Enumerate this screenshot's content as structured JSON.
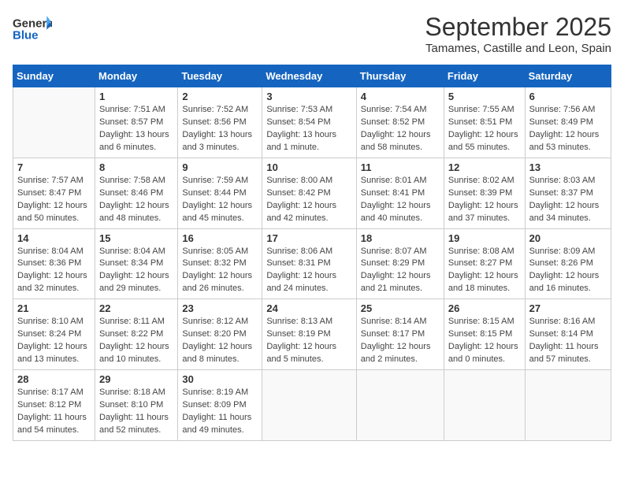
{
  "header": {
    "logo_line1": "General",
    "logo_line2": "Blue",
    "title": "September 2025",
    "subtitle": "Tamames, Castille and Leon, Spain"
  },
  "weekdays": [
    "Sunday",
    "Monday",
    "Tuesday",
    "Wednesday",
    "Thursday",
    "Friday",
    "Saturday"
  ],
  "weeks": [
    [
      {
        "day": "",
        "sunrise": "",
        "sunset": "",
        "daylight": ""
      },
      {
        "day": "1",
        "sunrise": "Sunrise: 7:51 AM",
        "sunset": "Sunset: 8:57 PM",
        "daylight": "Daylight: 13 hours and 6 minutes."
      },
      {
        "day": "2",
        "sunrise": "Sunrise: 7:52 AM",
        "sunset": "Sunset: 8:56 PM",
        "daylight": "Daylight: 13 hours and 3 minutes."
      },
      {
        "day": "3",
        "sunrise": "Sunrise: 7:53 AM",
        "sunset": "Sunset: 8:54 PM",
        "daylight": "Daylight: 13 hours and 1 minute."
      },
      {
        "day": "4",
        "sunrise": "Sunrise: 7:54 AM",
        "sunset": "Sunset: 8:52 PM",
        "daylight": "Daylight: 12 hours and 58 minutes."
      },
      {
        "day": "5",
        "sunrise": "Sunrise: 7:55 AM",
        "sunset": "Sunset: 8:51 PM",
        "daylight": "Daylight: 12 hours and 55 minutes."
      },
      {
        "day": "6",
        "sunrise": "Sunrise: 7:56 AM",
        "sunset": "Sunset: 8:49 PM",
        "daylight": "Daylight: 12 hours and 53 minutes."
      }
    ],
    [
      {
        "day": "7",
        "sunrise": "Sunrise: 7:57 AM",
        "sunset": "Sunset: 8:47 PM",
        "daylight": "Daylight: 12 hours and 50 minutes."
      },
      {
        "day": "8",
        "sunrise": "Sunrise: 7:58 AM",
        "sunset": "Sunset: 8:46 PM",
        "daylight": "Daylight: 12 hours and 48 minutes."
      },
      {
        "day": "9",
        "sunrise": "Sunrise: 7:59 AM",
        "sunset": "Sunset: 8:44 PM",
        "daylight": "Daylight: 12 hours and 45 minutes."
      },
      {
        "day": "10",
        "sunrise": "Sunrise: 8:00 AM",
        "sunset": "Sunset: 8:42 PM",
        "daylight": "Daylight: 12 hours and 42 minutes."
      },
      {
        "day": "11",
        "sunrise": "Sunrise: 8:01 AM",
        "sunset": "Sunset: 8:41 PM",
        "daylight": "Daylight: 12 hours and 40 minutes."
      },
      {
        "day": "12",
        "sunrise": "Sunrise: 8:02 AM",
        "sunset": "Sunset: 8:39 PM",
        "daylight": "Daylight: 12 hours and 37 minutes."
      },
      {
        "day": "13",
        "sunrise": "Sunrise: 8:03 AM",
        "sunset": "Sunset: 8:37 PM",
        "daylight": "Daylight: 12 hours and 34 minutes."
      }
    ],
    [
      {
        "day": "14",
        "sunrise": "Sunrise: 8:04 AM",
        "sunset": "Sunset: 8:36 PM",
        "daylight": "Daylight: 12 hours and 32 minutes."
      },
      {
        "day": "15",
        "sunrise": "Sunrise: 8:04 AM",
        "sunset": "Sunset: 8:34 PM",
        "daylight": "Daylight: 12 hours and 29 minutes."
      },
      {
        "day": "16",
        "sunrise": "Sunrise: 8:05 AM",
        "sunset": "Sunset: 8:32 PM",
        "daylight": "Daylight: 12 hours and 26 minutes."
      },
      {
        "day": "17",
        "sunrise": "Sunrise: 8:06 AM",
        "sunset": "Sunset: 8:31 PM",
        "daylight": "Daylight: 12 hours and 24 minutes."
      },
      {
        "day": "18",
        "sunrise": "Sunrise: 8:07 AM",
        "sunset": "Sunset: 8:29 PM",
        "daylight": "Daylight: 12 hours and 21 minutes."
      },
      {
        "day": "19",
        "sunrise": "Sunrise: 8:08 AM",
        "sunset": "Sunset: 8:27 PM",
        "daylight": "Daylight: 12 hours and 18 minutes."
      },
      {
        "day": "20",
        "sunrise": "Sunrise: 8:09 AM",
        "sunset": "Sunset: 8:26 PM",
        "daylight": "Daylight: 12 hours and 16 minutes."
      }
    ],
    [
      {
        "day": "21",
        "sunrise": "Sunrise: 8:10 AM",
        "sunset": "Sunset: 8:24 PM",
        "daylight": "Daylight: 12 hours and 13 minutes."
      },
      {
        "day": "22",
        "sunrise": "Sunrise: 8:11 AM",
        "sunset": "Sunset: 8:22 PM",
        "daylight": "Daylight: 12 hours and 10 minutes."
      },
      {
        "day": "23",
        "sunrise": "Sunrise: 8:12 AM",
        "sunset": "Sunset: 8:20 PM",
        "daylight": "Daylight: 12 hours and 8 minutes."
      },
      {
        "day": "24",
        "sunrise": "Sunrise: 8:13 AM",
        "sunset": "Sunset: 8:19 PM",
        "daylight": "Daylight: 12 hours and 5 minutes."
      },
      {
        "day": "25",
        "sunrise": "Sunrise: 8:14 AM",
        "sunset": "Sunset: 8:17 PM",
        "daylight": "Daylight: 12 hours and 2 minutes."
      },
      {
        "day": "26",
        "sunrise": "Sunrise: 8:15 AM",
        "sunset": "Sunset: 8:15 PM",
        "daylight": "Daylight: 12 hours and 0 minutes."
      },
      {
        "day": "27",
        "sunrise": "Sunrise: 8:16 AM",
        "sunset": "Sunset: 8:14 PM",
        "daylight": "Daylight: 11 hours and 57 minutes."
      }
    ],
    [
      {
        "day": "28",
        "sunrise": "Sunrise: 8:17 AM",
        "sunset": "Sunset: 8:12 PM",
        "daylight": "Daylight: 11 hours and 54 minutes."
      },
      {
        "day": "29",
        "sunrise": "Sunrise: 8:18 AM",
        "sunset": "Sunset: 8:10 PM",
        "daylight": "Daylight: 11 hours and 52 minutes."
      },
      {
        "day": "30",
        "sunrise": "Sunrise: 8:19 AM",
        "sunset": "Sunset: 8:09 PM",
        "daylight": "Daylight: 11 hours and 49 minutes."
      },
      {
        "day": "",
        "sunrise": "",
        "sunset": "",
        "daylight": ""
      },
      {
        "day": "",
        "sunrise": "",
        "sunset": "",
        "daylight": ""
      },
      {
        "day": "",
        "sunrise": "",
        "sunset": "",
        "daylight": ""
      },
      {
        "day": "",
        "sunrise": "",
        "sunset": "",
        "daylight": ""
      }
    ]
  ]
}
